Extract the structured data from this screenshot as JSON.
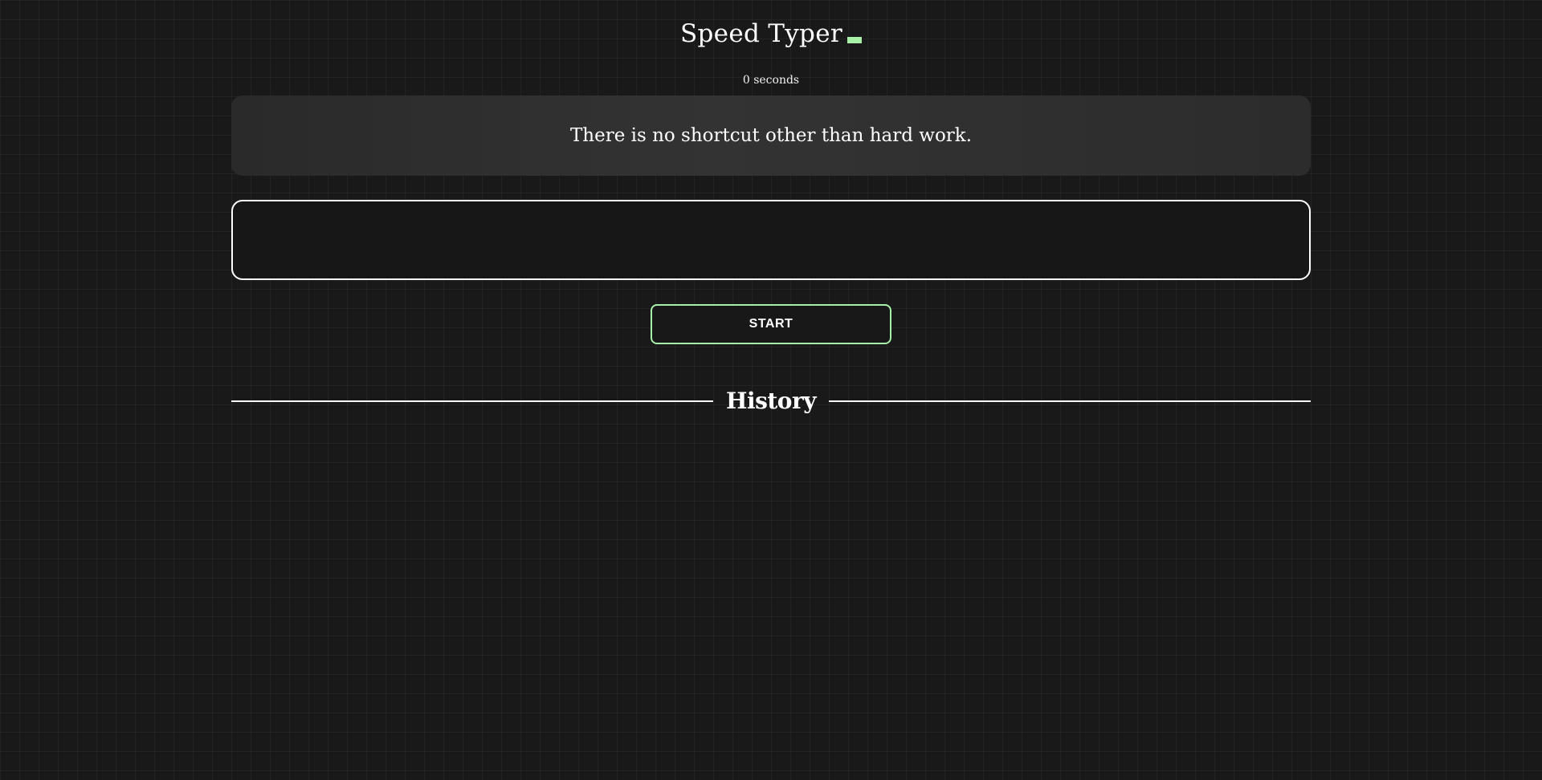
{
  "app": {
    "title": "Speed Typer"
  },
  "timer": {
    "label": "0 seconds"
  },
  "quote": {
    "text": "There is no shortcut other than hard work."
  },
  "input": {
    "value": "",
    "placeholder": ""
  },
  "controls": {
    "start_label": "START"
  },
  "history": {
    "heading": "History"
  },
  "colors": {
    "background": "#191919",
    "accent": "#a8f0a8",
    "text": "#ffffff"
  }
}
